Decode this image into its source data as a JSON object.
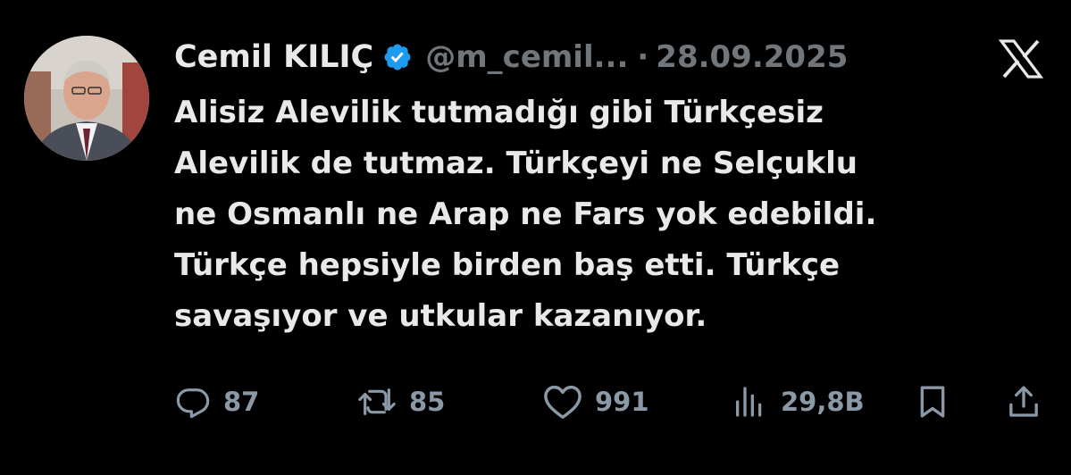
{
  "author": {
    "name": "Cemil KILIÇ",
    "handle": "@m_cemil...",
    "separator": "·",
    "date": "28.09.2025",
    "verified": true
  },
  "tweet": {
    "text": "Alisiz Alevilik tutmadığı gibi Türkçesiz\nAlevilik de tutmaz. Türkçeyi ne Selçuklu\nne Osmanlı ne Arap ne Fars yok edebildi.\nTürkçe hepsiyle birden baş etti. Türkçe\nsavaşıyor ve utkular kazanıyor."
  },
  "actions": {
    "replies": "87",
    "reposts": "85",
    "likes": "991",
    "views": "29,8B"
  },
  "icons": {
    "avatar": "profile-photo",
    "verified": "verified-badge-icon",
    "brand": "x-logo-icon",
    "reply": "reply-icon",
    "repost": "repost-icon",
    "like": "heart-icon",
    "views": "views-icon",
    "bookmark": "bookmark-icon",
    "share": "share-icon"
  },
  "colors": {
    "background": "#000000",
    "text": "#e7e9ea",
    "secondary": "#71767b",
    "verified": "#1d9bf0"
  }
}
